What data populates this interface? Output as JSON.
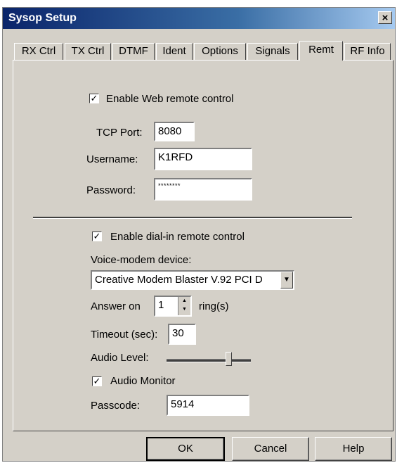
{
  "window": {
    "title": "Sysop Setup",
    "close_label": "×"
  },
  "tabs": [
    {
      "label": "RX Ctrl"
    },
    {
      "label": "TX Ctrl"
    },
    {
      "label": "DTMF"
    },
    {
      "label": "Ident"
    },
    {
      "label": "Options"
    },
    {
      "label": "Signals"
    },
    {
      "label": "Remt"
    },
    {
      "label": "RF Info"
    }
  ],
  "web_remote": {
    "enable_label": "Enable Web remote control",
    "enabled": true,
    "tcp_port_label": "TCP Port:",
    "tcp_port": "8080",
    "username_label": "Username:",
    "username": "K1RFD",
    "password_label": "Password:",
    "password": "********"
  },
  "dialin": {
    "enable_label": "Enable dial-in remote control",
    "enabled": true,
    "voice_modem_label": "Voice-modem device:",
    "voice_modem": "Creative Modem Blaster V.92 PCI D",
    "answer_on_label": "Answer on",
    "answer_on": "1",
    "rings_label": "ring(s)",
    "timeout_label": "Timeout (sec):",
    "timeout": "30",
    "audio_level_label": "Audio Level:",
    "audio_level": 0.7,
    "audio_monitor_label": "Audio Monitor",
    "audio_monitor": true,
    "passcode_label": "Passcode:",
    "passcode": "5914"
  },
  "buttons": {
    "ok": "OK",
    "cancel": "Cancel",
    "help": "Help"
  },
  "check_mark": "✓",
  "active_tab": "Remt"
}
